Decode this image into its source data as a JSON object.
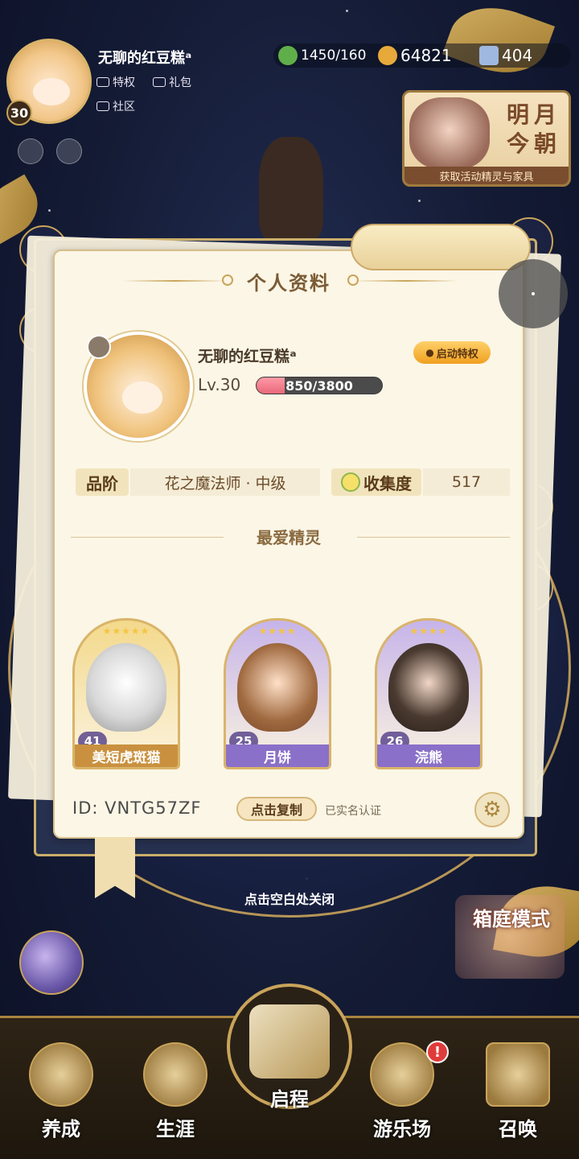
{
  "player": {
    "name": "无聊的红豆糕ᵃ",
    "level": "30",
    "link_privilege": "特权",
    "link_gift": "礼包",
    "link_community": "社区"
  },
  "resources": {
    "stamina": "1450/160",
    "coins": "64821",
    "gems": "404"
  },
  "event_banner": {
    "title": "明月今朝",
    "subtitle": "获取活动精灵与家具"
  },
  "profile": {
    "title": "个人资料",
    "name": "无聊的红豆糕ᵃ",
    "privilege_button": "启动特权",
    "level_label": "Lv.30",
    "exp_text": "850/3800",
    "exp_fraction": 0.2237,
    "rank_label": "品阶",
    "rank_value": "花之魔法师 · 中级",
    "collection_label": "收集度",
    "collection_value": "517",
    "favorites_title": "最爱精灵",
    "spirits": [
      {
        "name": "美短虎斑猫",
        "level": "41",
        "stars": "★★★★★",
        "color": "#f3d98b"
      },
      {
        "name": "月饼",
        "level": "25",
        "stars": "★★★★",
        "color": "#c6b4ea"
      },
      {
        "name": "浣熊",
        "level": "26",
        "stars": "★★★★",
        "color": "#c6b4ea"
      }
    ],
    "id_text": "ID: VNTG57ZF",
    "copy_button": "点击复制",
    "verified_text": "已实名认证"
  },
  "close_hint": "点击空白处关闭",
  "garden_mode": "箱庭模式",
  "nav": {
    "items": [
      "养成",
      "生涯",
      "启程",
      "游乐场",
      "召唤"
    ],
    "badge": "!"
  },
  "colors": {
    "accent_gold": "#c9a45a",
    "card_bg": "#fbf6e6",
    "exp_fill": "#e86878"
  }
}
